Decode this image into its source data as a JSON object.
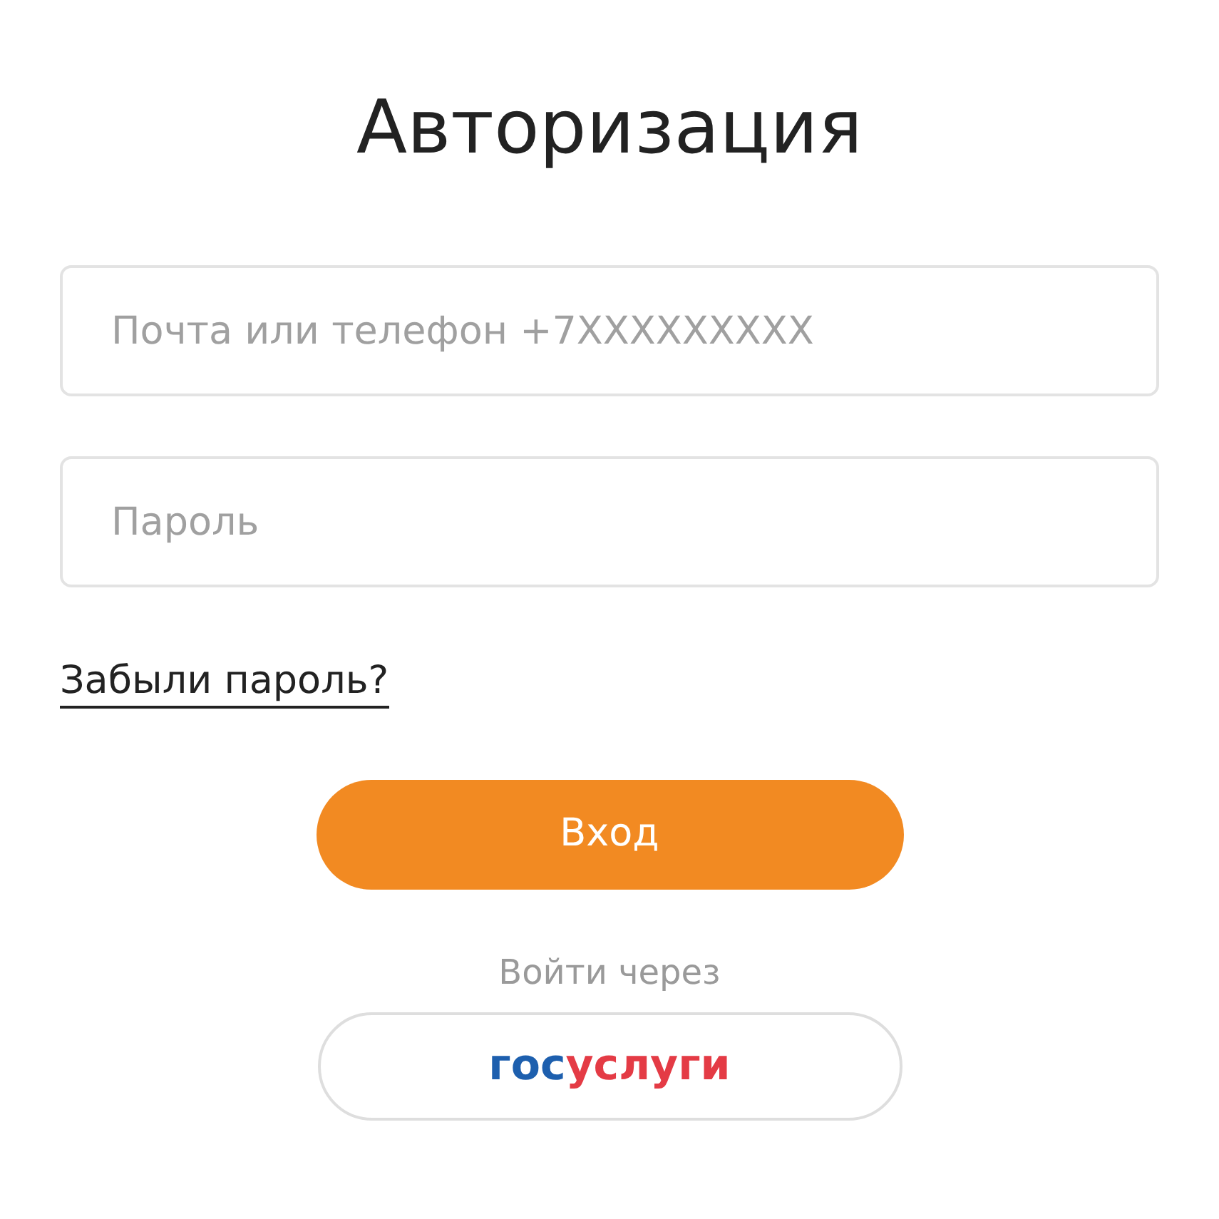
{
  "title": "Авторизация",
  "fields": [
    {
      "placeholder": "Почта или телефон +7XXXXXXXXX"
    },
    {
      "placeholder": "Пароль"
    }
  ],
  "forgot_link": "Забыли пароль?",
  "login_button": "Вход",
  "alt_login_label": "Войти через",
  "gosuslugi_button": {
    "logo_parts": [
      {
        "text": "гос",
        "color": "#1d5fae"
      },
      {
        "text": "услуги",
        "color": "#e43b45"
      }
    ]
  }
}
